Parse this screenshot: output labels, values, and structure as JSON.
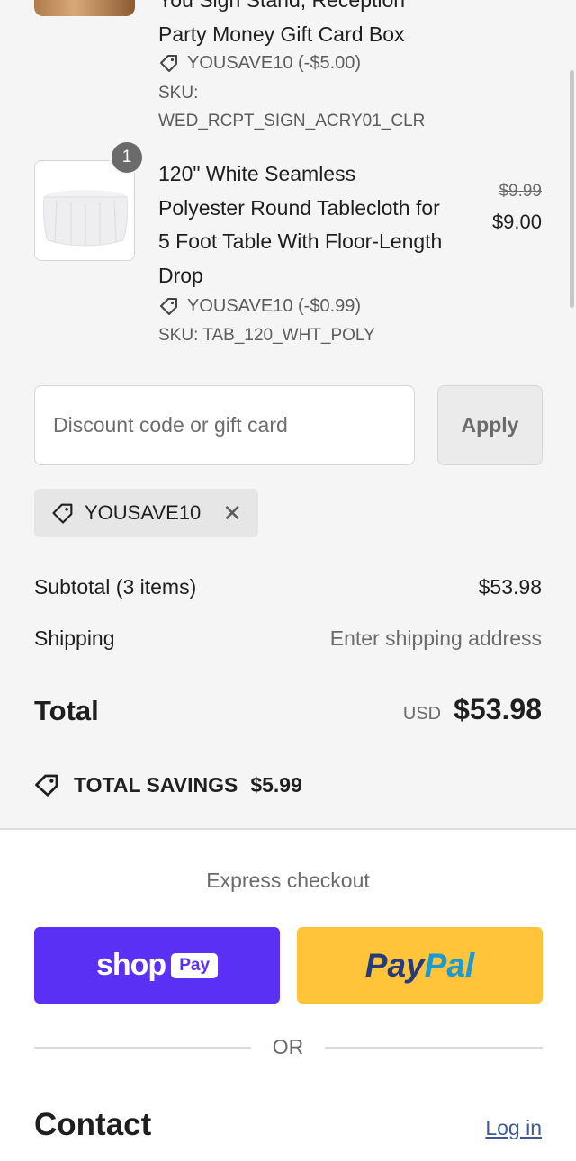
{
  "order_summary": {
    "items": [
      {
        "title_lines": [
          "You Sign Stand, Reception",
          "Party Money Gift Card Box"
        ],
        "discount": "YOUSAVE10 (-$5.00)",
        "sku_label": "SKU:",
        "sku_value": "WED_RCPT_SIGN_ACRY01_CLR"
      },
      {
        "quantity": "1",
        "title_lines": [
          "120\" White Seamless",
          "Polyester Round Tablecloth for",
          "5 Foot Table With Floor-Length",
          "Drop"
        ],
        "discount": "YOUSAVE10 (-$0.99)",
        "sku": "SKU: TAB_120_WHT_POLY",
        "original_price": "$9.99",
        "price": "$9.00"
      }
    ],
    "discount_input": {
      "placeholder": "Discount code or gift card"
    },
    "apply_label": "Apply",
    "applied_code": "YOUSAVE10",
    "subtotal_label": "Subtotal (3 items)",
    "subtotal_value": "$53.98",
    "shipping_label": "Shipping",
    "shipping_value": "Enter shipping address",
    "total_label": "Total",
    "currency": "USD",
    "total_value": "$53.98",
    "savings_label": "TOTAL SAVINGS",
    "savings_value": "$5.99"
  },
  "express": {
    "title": "Express checkout",
    "shop_word": "shop",
    "shop_pay_box": "Pay",
    "paypal_part1": "Pay",
    "paypal_part2": "Pal",
    "or_text": "OR"
  },
  "contact": {
    "title": "Contact",
    "login_link": "Log in"
  },
  "colors": {
    "shop_pay": "#5a31f4",
    "paypal_bg": "#ffc439",
    "paypal_dark": "#253b80",
    "paypal_light": "#179bd7",
    "link": "#3d5a96"
  },
  "icons": [
    "tag-icon",
    "close-icon",
    "savings-tag-icon"
  ]
}
